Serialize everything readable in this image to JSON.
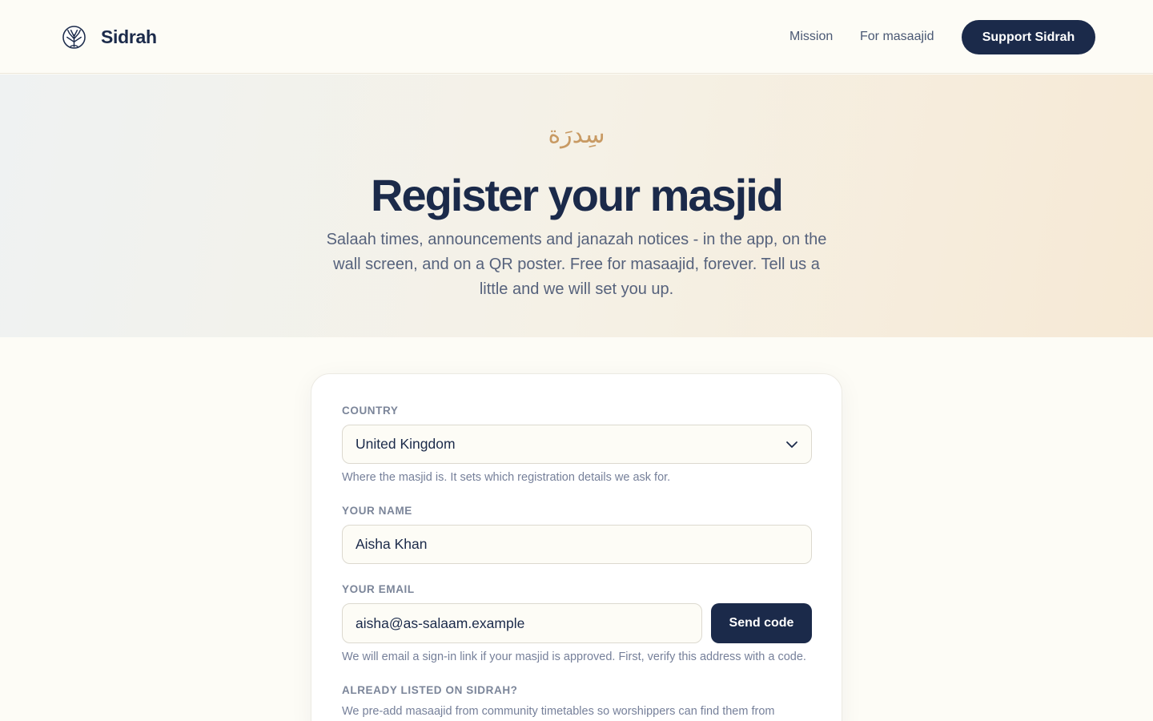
{
  "header": {
    "brand_name": "Sidrah",
    "brand_icon": "tree-icon",
    "nav": {
      "mission": "Mission",
      "for_masaajid": "For masaajid"
    },
    "support_label": "Support Sidrah"
  },
  "hero": {
    "arabic": "سِدرَة",
    "title": "Register your masjid",
    "subtitle": "Salaah times, announcements and janazah notices - in the app, on the wall screen, and on a QR poster. Free for masaajid, forever. Tell us a little and we will set you up."
  },
  "form": {
    "country": {
      "label": "Country",
      "value": "United Kingdom",
      "hint": "Where the masjid is. It sets which registration details we ask for."
    },
    "name": {
      "label": "Your name",
      "value": "Aisha Khan"
    },
    "email": {
      "label": "Your email",
      "value": "aisha@as-salaam.example",
      "send_label": "Send code",
      "hint": "We will email a sign-in link if your masjid is approved. First, verify this address with a code."
    },
    "already_listed": {
      "label": "Already listed on Sidrah?",
      "hint": "We pre-add masaajid from community timetables so worshippers can find them from"
    }
  },
  "colors": {
    "navy": "#1b2a4a",
    "gold": "#c89a63",
    "background": "#fdfcf6"
  }
}
